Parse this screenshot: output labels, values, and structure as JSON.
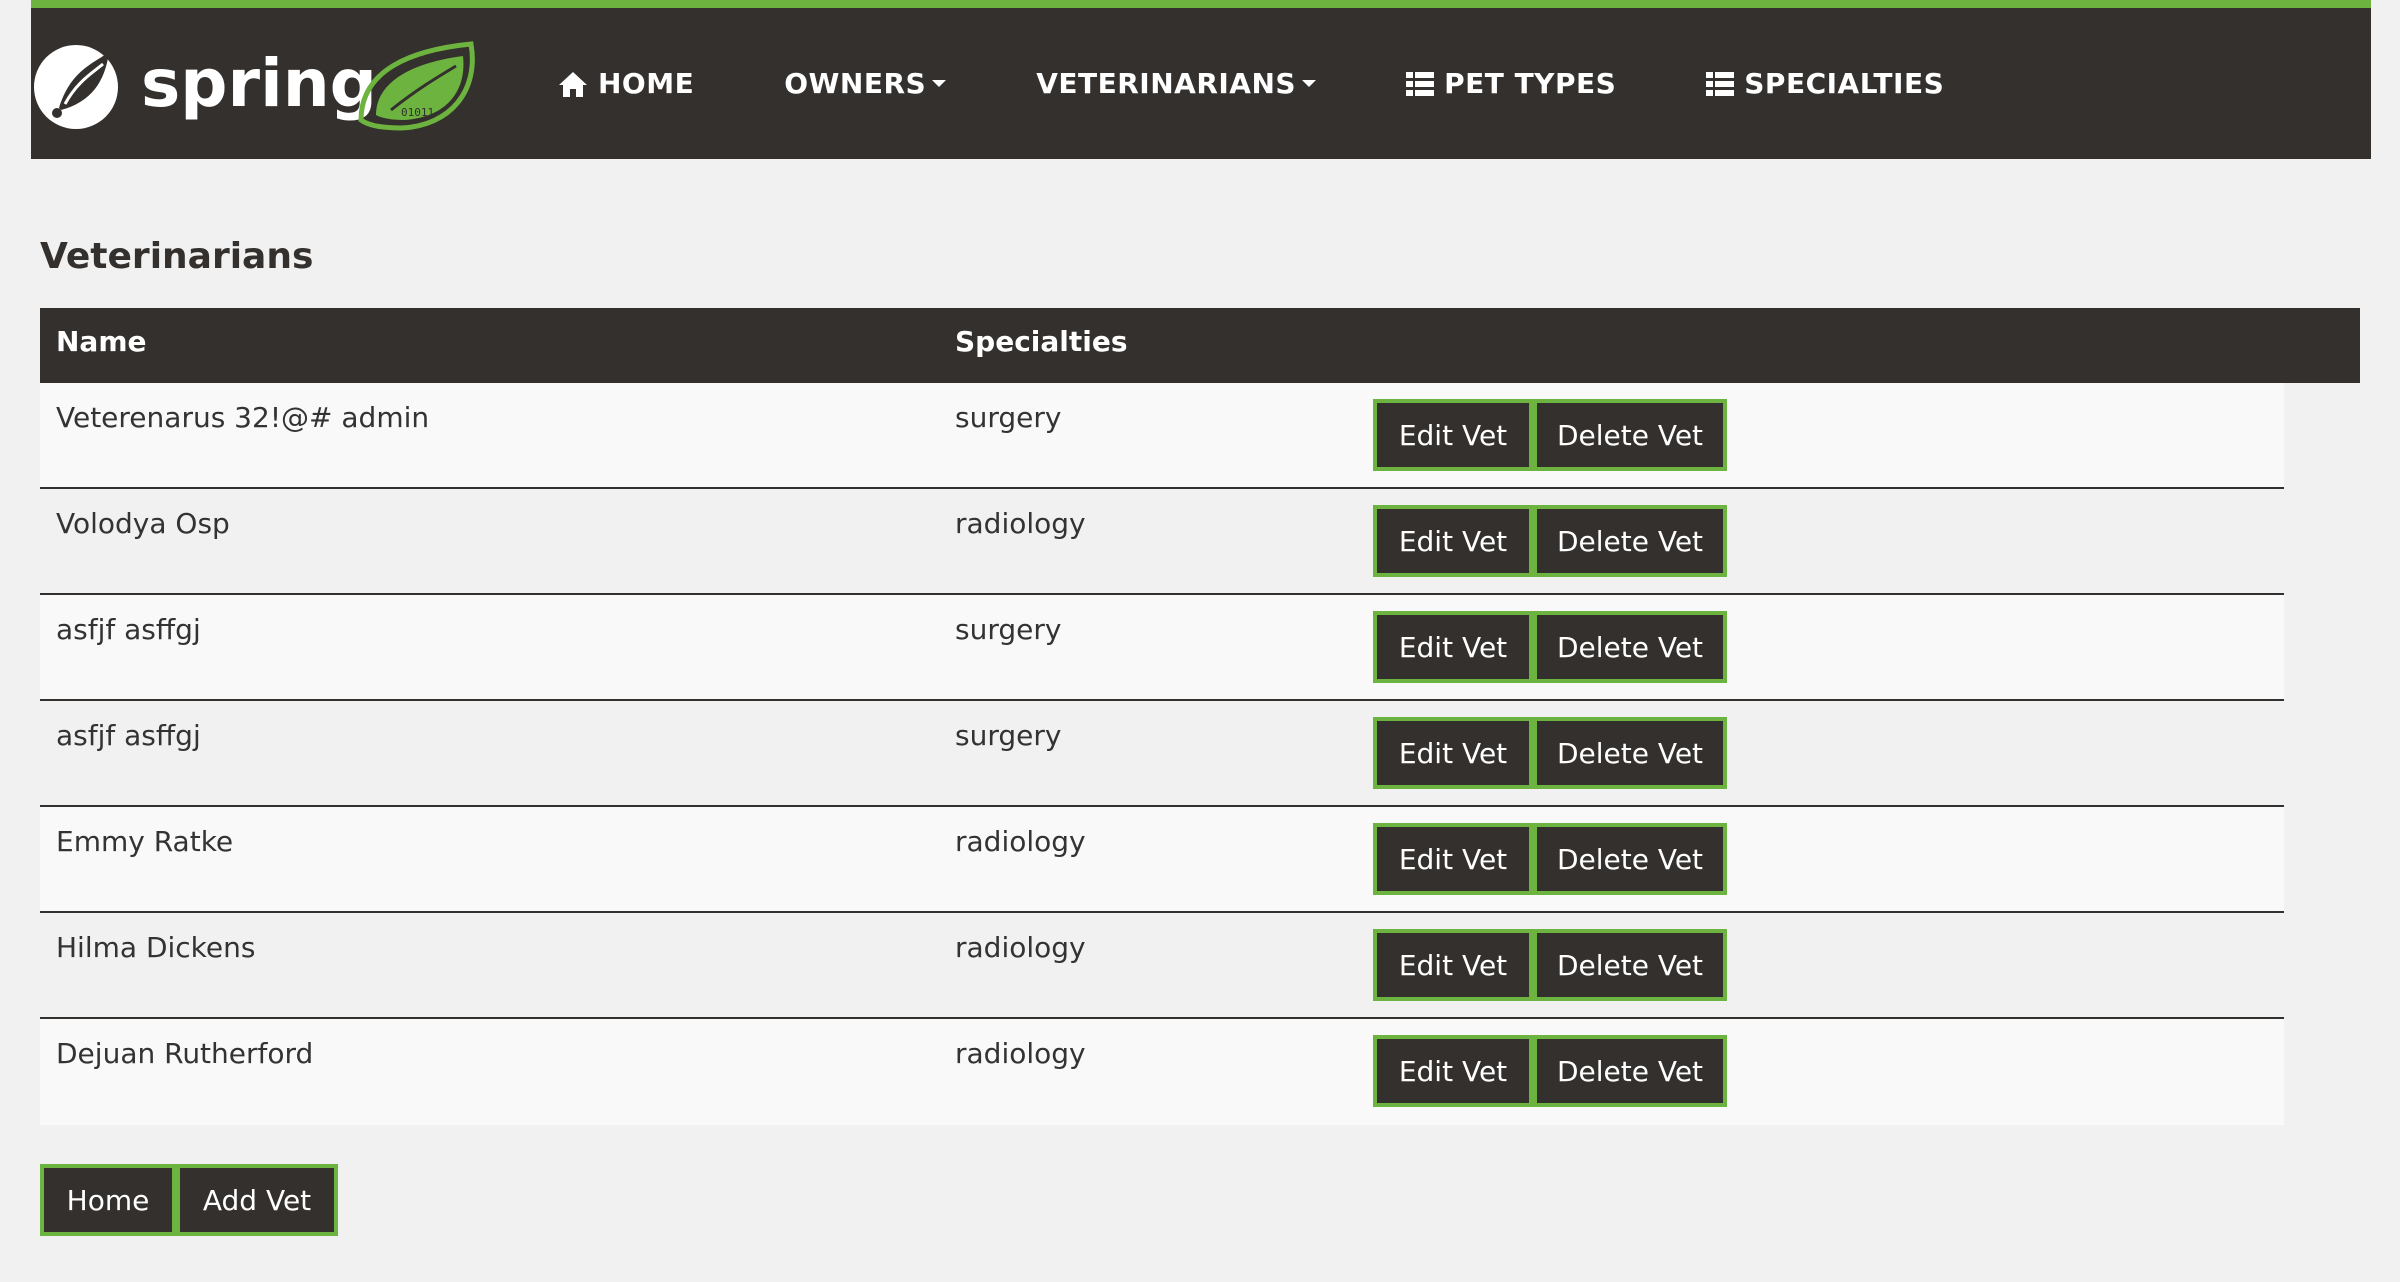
{
  "brand": {
    "logo_text": "spring",
    "leaf_digits": "01011"
  },
  "nav": {
    "items": [
      {
        "label": "HOME",
        "icon": "home-icon",
        "dropdown": false
      },
      {
        "label": "OWNERS",
        "icon": "",
        "dropdown": true
      },
      {
        "label": "VETERINARIANS",
        "icon": "",
        "dropdown": true
      },
      {
        "label": "PET TYPES",
        "icon": "list-icon",
        "dropdown": false
      },
      {
        "label": "SPECIALTIES",
        "icon": "list-icon",
        "dropdown": false
      }
    ]
  },
  "page": {
    "title": "Veterinarians"
  },
  "table": {
    "headers": {
      "name": "Name",
      "specialties": "Specialties"
    },
    "rows": [
      {
        "name": "Veterenarus 32!@# admin",
        "specialties": "surgery"
      },
      {
        "name": "Volodya Osp",
        "specialties": "radiology"
      },
      {
        "name": "asfjf asffgj",
        "specialties": "surgery"
      },
      {
        "name": "asfjf asffgj",
        "specialties": "surgery"
      },
      {
        "name": "Emmy Ratke",
        "specialties": "radiology"
      },
      {
        "name": "Hilma Dickens",
        "specialties": "radiology"
      },
      {
        "name": "Dejuan Rutherford",
        "specialties": "radiology"
      }
    ],
    "row_actions": {
      "edit": "Edit Vet",
      "delete": "Delete Vet"
    }
  },
  "footer": {
    "home_label": "Home",
    "add_label": "Add Vet"
  },
  "colors": {
    "dark": "#34302d",
    "accent": "#6db33f",
    "background": "#f1f1f1"
  }
}
